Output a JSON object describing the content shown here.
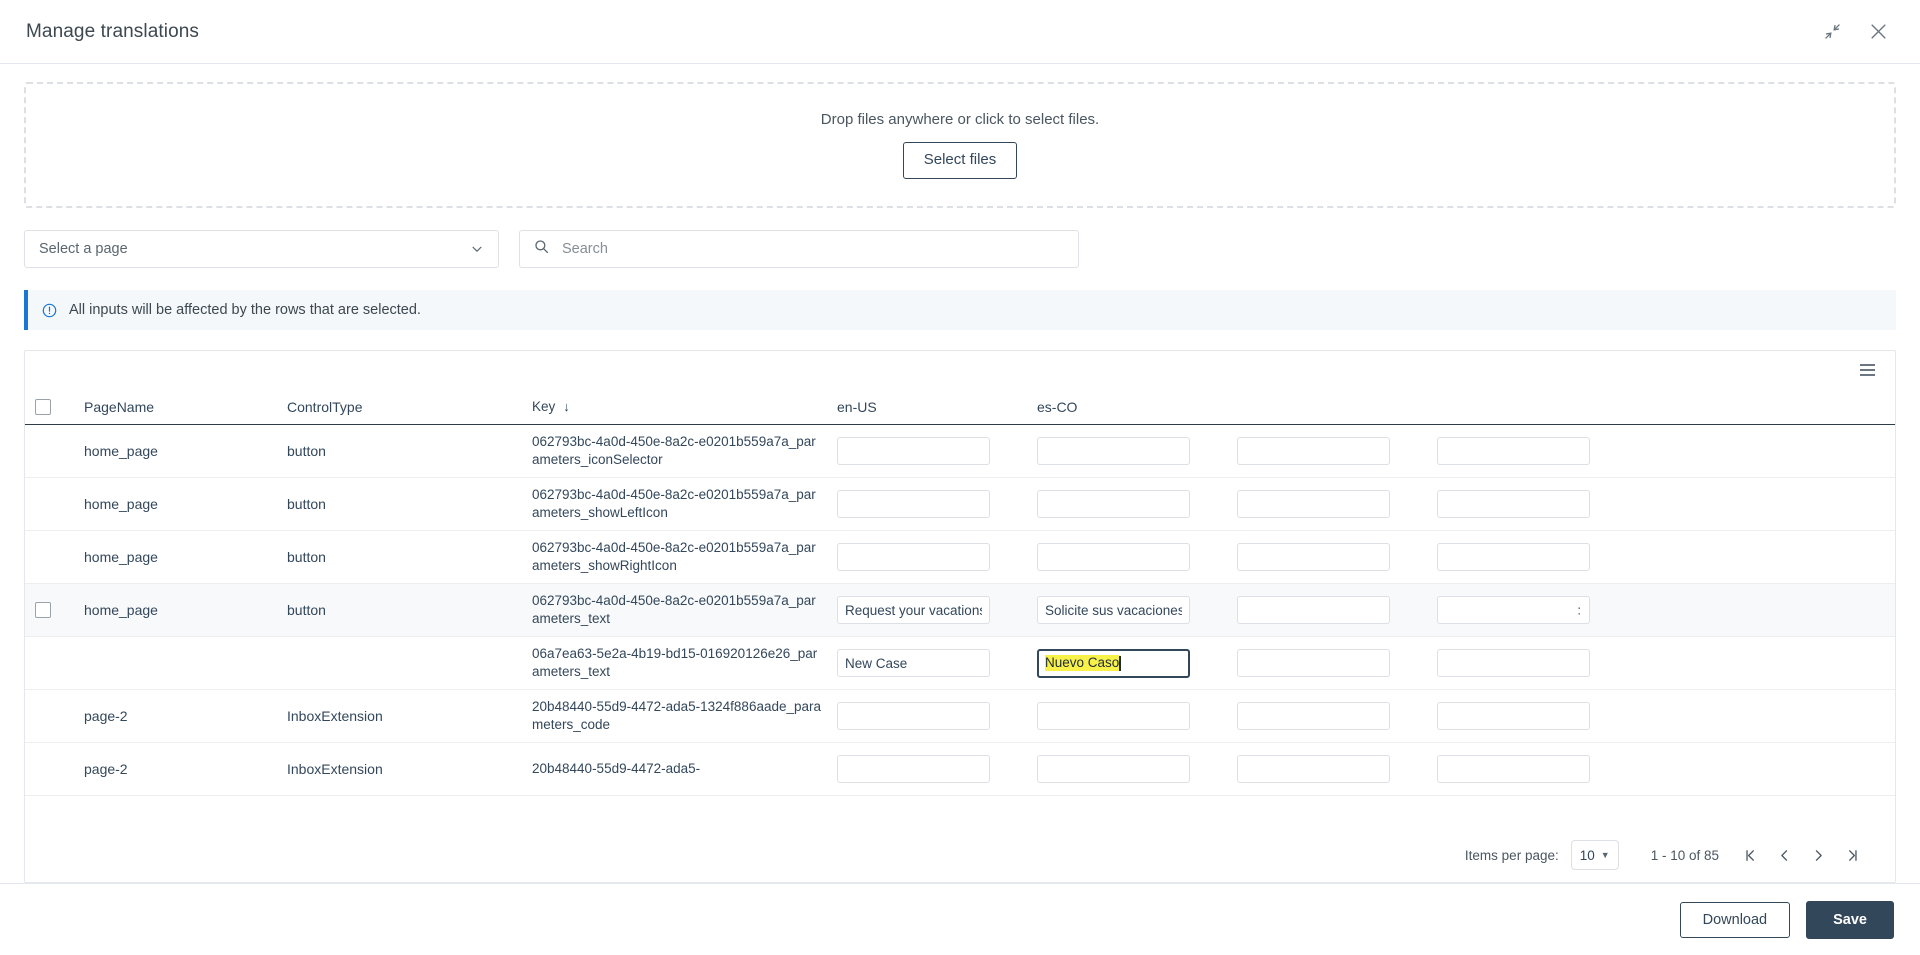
{
  "dialog": {
    "title": "Manage translations",
    "minimize_icon": "collapse-arrows-icon",
    "close_icon": "close-icon"
  },
  "dropzone": {
    "text": "Drop files anywhere or click to select files.",
    "button_label": "Select files"
  },
  "filters": {
    "page_select_label": "Select a page",
    "page_select_icon": "chevron-down-icon",
    "search_placeholder": "Search",
    "search_value": "",
    "search_icon": "search-icon"
  },
  "banner": {
    "icon": "info-circle-icon",
    "text": "All inputs will be affected by the rows that are selected."
  },
  "table": {
    "menu_icon": "hamburger-menu-icon",
    "columns": [
      {
        "label": "PageName",
        "sorted": false
      },
      {
        "label": "ControlType",
        "sorted": false
      },
      {
        "label": "Key",
        "sorted": true,
        "sort_arrow": "↓"
      },
      {
        "label": "en-US",
        "sorted": false
      },
      {
        "label": "es-CO",
        "sorted": false
      }
    ],
    "rows": [
      {
        "checkbox": false,
        "page_name": "home_page",
        "control_type": "button",
        "key": "062793bc-4a0d-450e-8a2c-e0201b559a7a_parameters_iconSelector",
        "en_us": "",
        "es_co": "",
        "col4": "",
        "col5": "",
        "selected": false,
        "focused_cell": null
      },
      {
        "checkbox": false,
        "page_name": "home_page",
        "control_type": "button",
        "key": "062793bc-4a0d-450e-8a2c-e0201b559a7a_parameters_showLeftIcon",
        "en_us": "",
        "es_co": "",
        "col4": "",
        "col5": "",
        "selected": false,
        "focused_cell": null
      },
      {
        "checkbox": false,
        "page_name": "home_page",
        "control_type": "button",
        "key": "062793bc-4a0d-450e-8a2c-e0201b559a7a_parameters_showRightIcon",
        "en_us": "",
        "es_co": "",
        "col4": "",
        "col5": "",
        "selected": false,
        "focused_cell": null
      },
      {
        "checkbox": true,
        "page_name": "home_page",
        "control_type": "button",
        "key": "062793bc-4a0d-450e-8a2c-e0201b559a7a_parameters_text",
        "en_us": "Request your vacations",
        "es_co": "Solicite sus vacaciones",
        "col4": "",
        "col5": ":",
        "selected": true,
        "focused_cell": null
      },
      {
        "checkbox": false,
        "page_name": "",
        "control_type": "",
        "key": "06a7ea63-5e2a-4b19-bd15-016920126e26_parameters_text",
        "en_us": "New Case",
        "es_co": "Nuevo Caso",
        "col4": "",
        "col5": "",
        "selected": false,
        "focused_cell": "es_co"
      },
      {
        "checkbox": false,
        "page_name": "page-2",
        "control_type": "InboxExtension",
        "key": "20b48440-55d9-4472-ada5-1324f886aade_parameters_code",
        "en_us": "",
        "es_co": "",
        "col4": "",
        "col5": "",
        "selected": false,
        "focused_cell": null
      },
      {
        "checkbox": false,
        "page_name": "page-2",
        "control_type": "InboxExtension",
        "key": "20b48440-55d9-4472-ada5-",
        "en_us": "",
        "es_co": "",
        "col4": "",
        "col5": "",
        "selected": false,
        "focused_cell": null
      }
    ]
  },
  "paginator": {
    "items_per_page_label": "Items per page:",
    "items_per_page_value": "10",
    "dropdown_icon": "triangle-down-icon",
    "range_label": "1 - 10 of 85",
    "first_page_icon": "first-page-icon",
    "prev_page_icon": "chevron-left-icon",
    "next_page_icon": "chevron-right-icon",
    "last_page_icon": "last-page-icon"
  },
  "footer": {
    "download_label": "Download",
    "save_label": "Save"
  },
  "colors": {
    "primary": "#33475b",
    "info": "#1976d2",
    "highlight": "#f7f14a",
    "border": "#e4e7eb"
  }
}
